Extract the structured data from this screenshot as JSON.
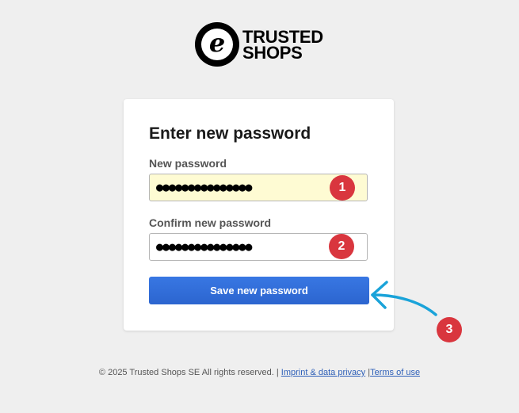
{
  "logo": {
    "mark_letter": "e",
    "line1": "TRUSTED",
    "line2": "SHOPS"
  },
  "form": {
    "title": "Enter new password",
    "new_password_label": "New password",
    "new_password_value": "●●●●●●●●●●●●●●●",
    "confirm_password_label": "Confirm new password",
    "confirm_password_value": "●●●●●●●●●●●●●●●",
    "save_label": "Save new password"
  },
  "annotations": {
    "badge1": "1",
    "badge2": "2",
    "badge3": "3",
    "badge_color": "#d9363e",
    "arrow_color": "#1aa3d9"
  },
  "footer": {
    "copyright": "© 2025 Trusted Shops SE All rights reserved.",
    "separator": "|",
    "imprint_link": "Imprint & data privacy",
    "terms_link": "Terms of use"
  },
  "colors": {
    "background": "#efefef",
    "button": "#2f6bd6",
    "autofill": "#fefbd3"
  }
}
